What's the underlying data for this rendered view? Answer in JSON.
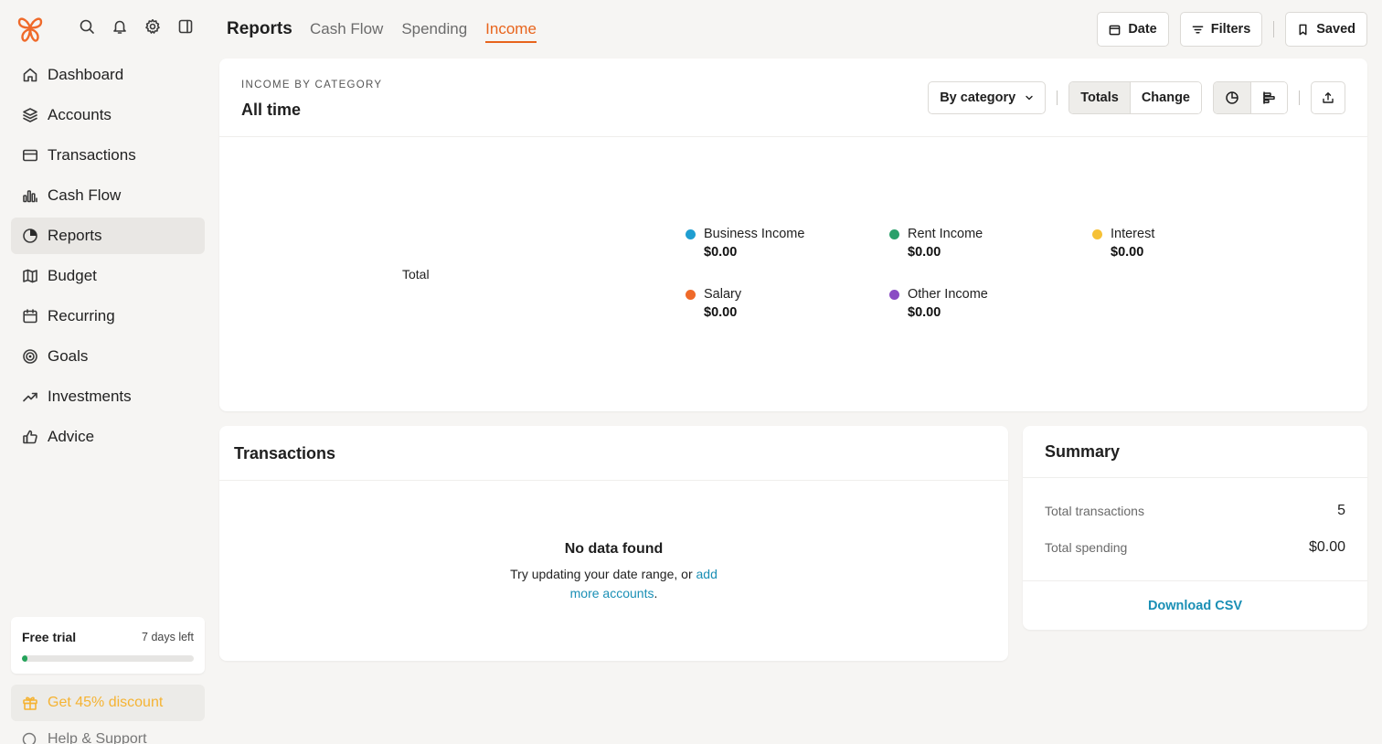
{
  "sidebar": {
    "nav": [
      {
        "label": "Dashboard",
        "icon": "home-icon"
      },
      {
        "label": "Accounts",
        "icon": "layers-icon"
      },
      {
        "label": "Transactions",
        "icon": "card-icon"
      },
      {
        "label": "Cash Flow",
        "icon": "bar-chart-icon"
      },
      {
        "label": "Reports",
        "icon": "pie-chart-icon",
        "active": true
      },
      {
        "label": "Budget",
        "icon": "map-icon"
      },
      {
        "label": "Recurring",
        "icon": "calendar-icon"
      },
      {
        "label": "Goals",
        "icon": "target-icon"
      },
      {
        "label": "Investments",
        "icon": "trending-up-icon"
      },
      {
        "label": "Advice",
        "icon": "thumbs-up-icon"
      }
    ],
    "trial": {
      "title": "Free trial",
      "days_left": "7 days left",
      "progress": 0.03
    },
    "discount": {
      "label": "Get 45% discount",
      "color": "#f5b333"
    },
    "help": {
      "label": "Help & Support"
    }
  },
  "header": {
    "title": "Reports",
    "tabs": [
      {
        "label": "Cash Flow"
      },
      {
        "label": "Spending"
      },
      {
        "label": "Income",
        "active": true
      }
    ],
    "buttons": {
      "date": "Date",
      "filters": "Filters",
      "saved": "Saved"
    },
    "accent": "#e8641c"
  },
  "chart_card": {
    "eyebrow": "INCOME BY CATEGORY",
    "title": "All time",
    "group_by": "By category",
    "segment": {
      "totals": "Totals",
      "change": "Change"
    },
    "total_label": "Total"
  },
  "chart_data": {
    "type": "pie",
    "categories": [
      "Business Income",
      "Rent Income",
      "Interest",
      "Salary",
      "Other Income"
    ],
    "values": [
      0,
      0,
      0,
      0,
      0
    ],
    "value_labels": [
      "$0.00",
      "$0.00",
      "$0.00",
      "$0.00",
      "$0.00"
    ],
    "colors": [
      "#1f9ed1",
      "#2aa06a",
      "#f6c136",
      "#ef6a2a",
      "#8a4bc4"
    ],
    "legend_position": "right"
  },
  "transactions": {
    "title": "Transactions",
    "empty_title": "No data found",
    "empty_text": "Try updating your date range, or ",
    "empty_link": "add more accounts",
    "empty_suffix": "."
  },
  "summary": {
    "title": "Summary",
    "rows": [
      {
        "label": "Total transactions",
        "value": "5"
      },
      {
        "label": "Total spending",
        "value": "$0.00"
      }
    ],
    "download": "Download CSV"
  }
}
